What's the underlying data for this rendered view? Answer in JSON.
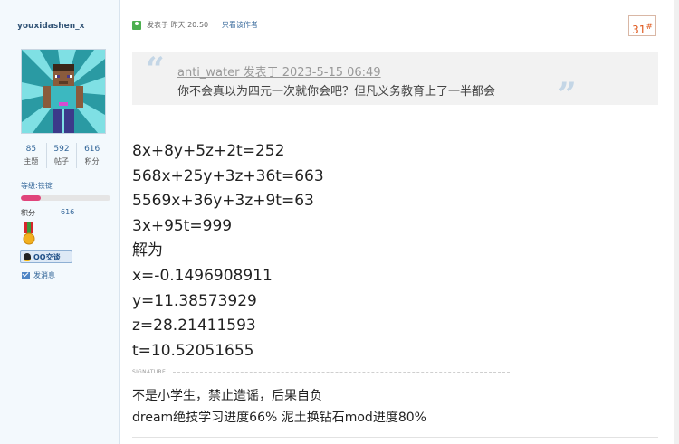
{
  "author": {
    "username": "youxidashen_x",
    "stats": [
      {
        "value": "85",
        "label": "主题"
      },
      {
        "value": "592",
        "label": "帖子"
      },
      {
        "value": "616",
        "label": "积分"
      }
    ],
    "level": "等级:铁锭",
    "level_progress": 0.22,
    "points_label": "积分",
    "points_value": "616",
    "qq_label": "QQ交谈",
    "message_label": "发消息",
    "level_color": "#e0457b"
  },
  "post": {
    "posted_at": "发表于 昨天 20:50",
    "only_author": "只看该作者",
    "floor": "31",
    "floor_mark": "#",
    "quote": {
      "author_line": "anti_water 发表于 2023-5-15 06:49",
      "text": "你不会真以为四元一次就你会吧？但凡义务教育上了一半都会"
    },
    "lines": [
      "8x+8y+5z+2t=252",
      "568x+25y+3z+36t=663",
      "5569x+36y+3z+9t=63",
      "3x+95t=999",
      "解为",
      "x=-0.1496908911",
      "y=11.38573929",
      "z=28.21411593",
      "t=10.52051655"
    ]
  },
  "signature": {
    "label": "SIGNATURE",
    "lines": [
      "不是小学生，禁止造谣，后果自负",
      "dream绝技学习进度66% 泥土换钻石mod进度80%"
    ]
  }
}
